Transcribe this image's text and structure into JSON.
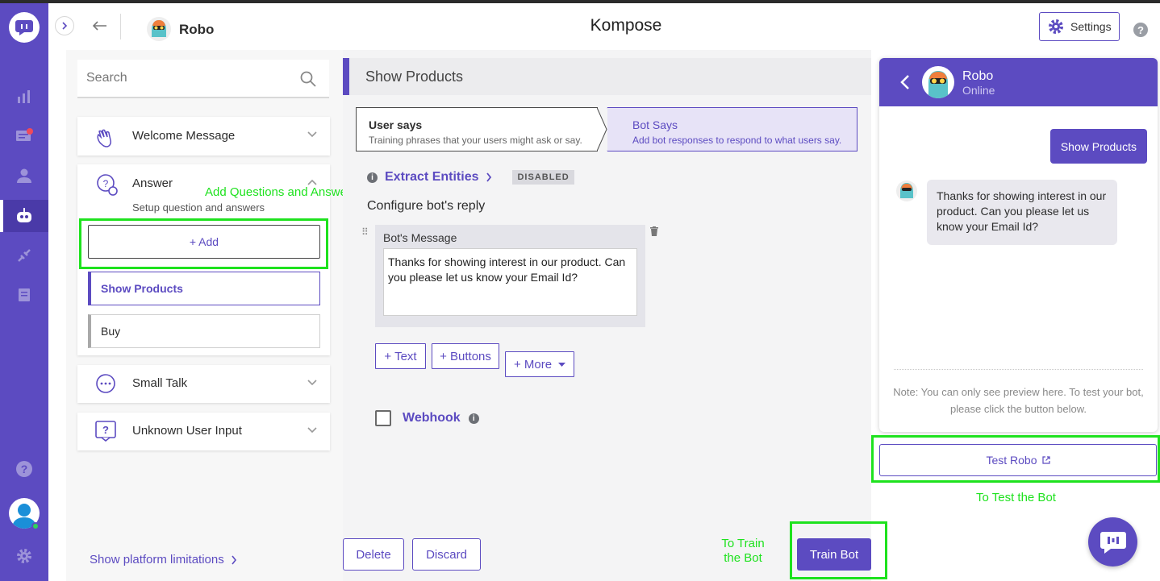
{
  "header": {
    "bot_name": "Robo",
    "title": "Kompose",
    "settings_label": "Settings",
    "help": "?"
  },
  "sidebar_search": {
    "placeholder": "Search"
  },
  "intents": {
    "welcome": "Welcome Message",
    "answer": "Answer",
    "answer_sub": "Setup question and answers",
    "add_label": "+ Add",
    "items": [
      "Show Products",
      "Buy"
    ],
    "small_talk": "Small Talk",
    "unknown": "Unknown User Input"
  },
  "platform_link": "Show platform limitations",
  "editor": {
    "intent_title": "Show Products",
    "user_says_title": "User says",
    "user_says_sub": "Training phrases that your users might ask or say.",
    "bot_says_title": "Bot Says",
    "bot_says_sub": "Add bot responses to respond to what users say.",
    "extract_label": "Extract Entities",
    "extract_status": "DISABLED",
    "configure_label": "Configure bot's reply",
    "message_label": "Bot's Message",
    "message_text": "Thanks for showing interest in our product. Can you please let us know your Email Id?",
    "btn_text": "+ Text",
    "btn_buttons": "+ Buttons",
    "btn_more": "+ More",
    "webhook_label": "Webhook"
  },
  "footer": {
    "delete": "Delete",
    "discard": "Discard",
    "train": "Train Bot"
  },
  "preview": {
    "bot_name": "Robo",
    "status": "Online",
    "user_msg": "Show Products",
    "bot_msg": "Thanks for showing interest in our product. Can you please let us know your Email Id?",
    "note": "Note: You can only see preview here. To test your bot, please click the button below.",
    "test_label": "Test Robo"
  },
  "annotations": {
    "add_qa": "Add Questions and Answers",
    "train_line1": "To Train",
    "train_line2": "the Bot",
    "test": "To Test the Bot"
  },
  "colors": {
    "brand": "#5c4bc1",
    "highlight": "#1ee21e",
    "rail": "#5c4bc1"
  },
  "icons": {
    "rail": [
      "logo-chat-icon",
      "analytics-icon",
      "conversations-icon",
      "users-icon",
      "bot-icon",
      "integrations-icon",
      "reports-icon",
      "help-icon",
      "settings-icon"
    ]
  }
}
